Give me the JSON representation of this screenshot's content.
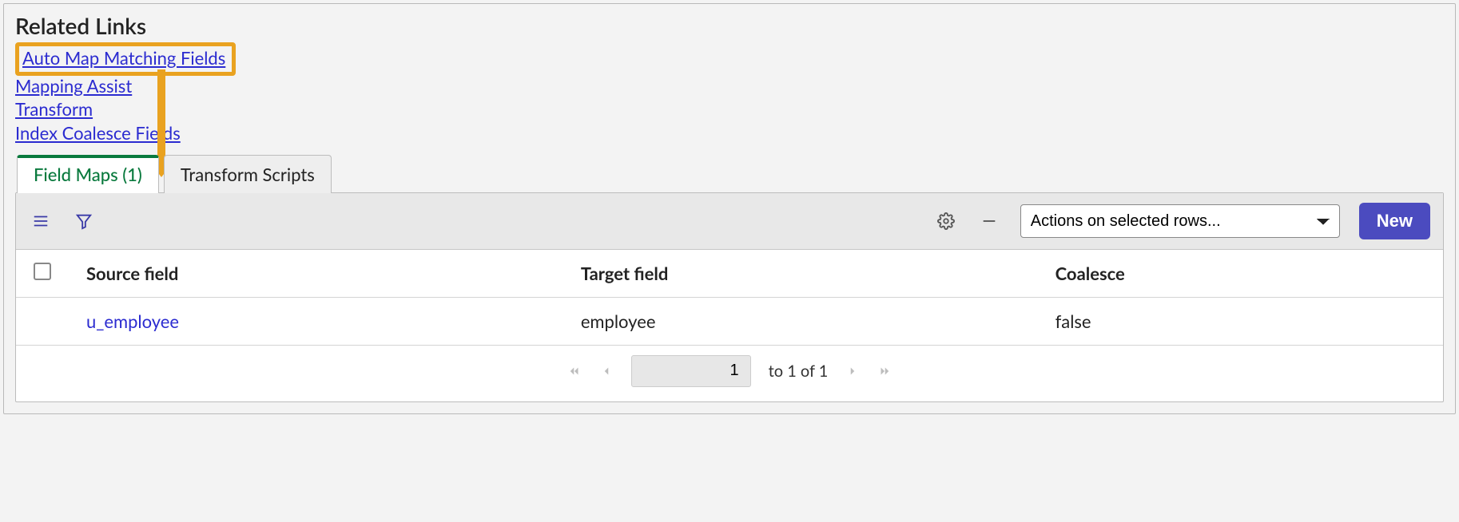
{
  "section_title": "Related Links",
  "related_links": {
    "auto_map": "Auto Map Matching Fields",
    "mapping_assist": "Mapping Assist",
    "transform": "Transform",
    "index_coalesce": "Index Coalesce Fields"
  },
  "tabs": {
    "field_maps": "Field Maps (1)",
    "transform_scripts": "Transform Scripts"
  },
  "toolbar": {
    "actions_placeholder": "Actions on selected rows...",
    "new_label": "New"
  },
  "columns": {
    "source": "Source field",
    "target": "Target field",
    "coalesce": "Coalesce"
  },
  "rows": [
    {
      "source": "u_employee",
      "target": "employee",
      "coalesce": "false"
    }
  ],
  "pager": {
    "page_input": "1",
    "range_text": "to 1 of 1"
  }
}
